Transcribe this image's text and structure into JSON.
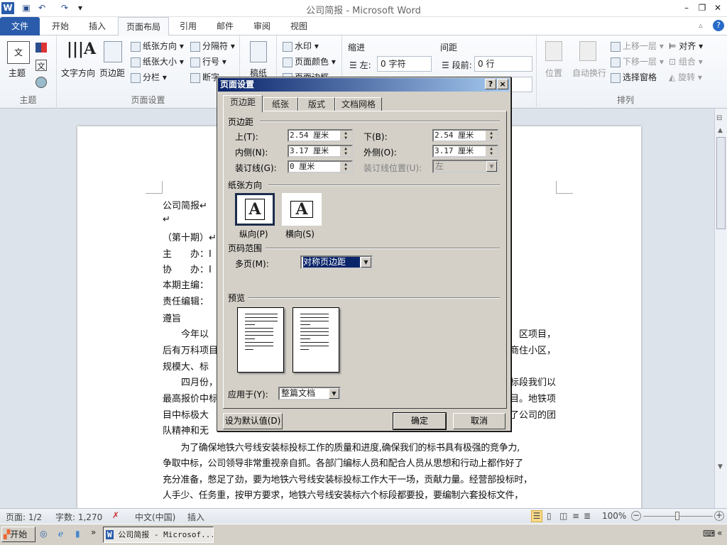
{
  "window": {
    "title": "公司简报 - Microsoft Word"
  },
  "ribbon_tabs": [
    "文件",
    "开始",
    "插入",
    "页面布局",
    "引用",
    "邮件",
    "审阅",
    "视图"
  ],
  "active_tab": "页面布局",
  "ribbon": {
    "themes": {
      "label": "主题",
      "button": "主题"
    },
    "page_setup": {
      "label": "页面设置",
      "text_direction": "文字方向",
      "margins": "页边距",
      "orientation": "纸张方向",
      "size": "纸张大小",
      "columns": "分栏",
      "breaks": "分隔符",
      "line_numbers": "行号",
      "hyphenation": "断字"
    },
    "draft": {
      "button": "稿纸"
    },
    "background": {
      "watermark": "水印",
      "page_color": "页面颜色",
      "page_borders": "页面边框"
    },
    "paragraph": {
      "indent": "缩进",
      "indent_left_label": "左:",
      "indent_left": "0 字符",
      "spacing": "间距",
      "spacing_before_label": "段前:",
      "spacing_before": "0 行"
    },
    "arrange": {
      "label": "排列",
      "position": "位置",
      "wrap_text": "自动换行",
      "bring_forward": "上移一层",
      "send_backward": "下移一层",
      "selection_pane": "选择窗格",
      "align": "对齐",
      "group": "组合",
      "rotate": "旋转"
    }
  },
  "document": {
    "lines": [
      {
        "left": "公司简报↵",
        "right": ""
      },
      {
        "left": "↵",
        "right": ""
      },
      {
        "left": "（第十期）↵",
        "right": ""
      },
      {
        "left": "主　　办：Ⅰ",
        "right": ""
      },
      {
        "left": "协　　办：Ⅰ",
        "right": ""
      },
      {
        "left": "本期主编：",
        "right": ""
      },
      {
        "left": "责任编辑：",
        "right": ""
      },
      {
        "left": "遵旨",
        "right": ""
      },
      {
        "left": "　　今年以",
        "right": "区项目，"
      },
      {
        "left": "后有万科项目",
        "right": "商住小区，"
      },
      {
        "left": "规模大、标",
        "right": ""
      },
      {
        "left": "　　四月份，",
        "right": "标段我们以"
      },
      {
        "left": "最高报价中标",
        "right": "目。地铁项"
      },
      {
        "left": "目中标极大",
        "right": "了公司的团"
      },
      {
        "left": "队精神和无",
        "right": ""
      },
      {
        "left": "　　为了确保地铁六号线安装标投标工作的质量和进度,确保我们的标书具有极强的竞争力,",
        "right": ""
      },
      {
        "left": "争取中标，公司领导非常重视亲自抓。各部门编标人员和配合人员从思想和行动上都作好了",
        "right": ""
      },
      {
        "left": "充分准备，憋足了劲，要为地铁六号线安装标投标工作大干一场，贡献力量。经营部投标时，",
        "right": ""
      },
      {
        "left": "人手少、任务重，按甲方要求，地铁六号线安装标六个标段都要投，要编制六套投标文件，",
        "right": ""
      }
    ]
  },
  "dialog": {
    "title": "页面设置",
    "help": "?",
    "close": "×",
    "tabs": [
      "页边距",
      "纸张",
      "版式",
      "文档网格"
    ],
    "margins_section": "页边距",
    "top_label": "上(T):",
    "top": "2.54 厘米",
    "bottom_label": "下(B):",
    "bottom": "2.54 厘米",
    "inside_label": "内侧(N):",
    "inside": "3.17 厘米",
    "outside_label": "外侧(O):",
    "outside": "3.17 厘米",
    "gutter_label": "装订线(G):",
    "gutter": "0 厘米",
    "gutter_pos_label": "装订线位置(U):",
    "gutter_pos": "左",
    "orientation_section": "纸张方向",
    "portrait": "纵向(P)",
    "landscape": "横向(S)",
    "selected_orientation": "portrait",
    "pages_section": "页码范围",
    "multiple_pages_label": "多页(M):",
    "multiple_pages": "对称页边距",
    "preview_section": "预览",
    "apply_to_label": "应用于(Y):",
    "apply_to": "整篇文档",
    "set_default": "设为默认值(D)",
    "ok": "确定",
    "cancel": "取消"
  },
  "status": {
    "page": "页面: 1/2",
    "words": "字数: 1,270",
    "language": "中文(中国)",
    "mode": "插入",
    "zoom": "100%",
    "zoom_percent": 100
  },
  "taskbar": {
    "start": "开始",
    "task": "公司简报 - Microsof..."
  }
}
